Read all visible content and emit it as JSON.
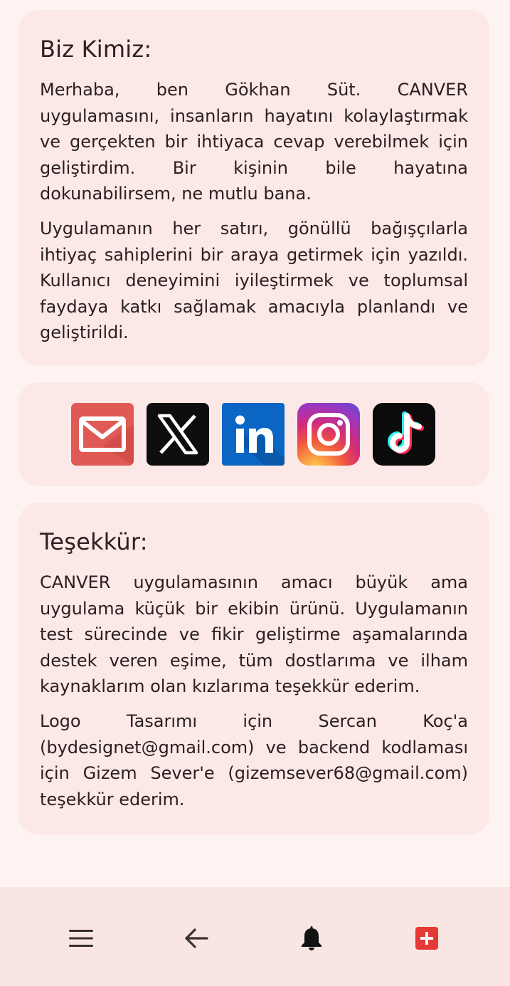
{
  "about": {
    "title": "Biz Kimiz:",
    "paragraphs": [
      "Merhaba, ben Gökhan Süt. CANVER uygulamasını, insanların hayatını kolaylaştırmak ve gerçekten bir ihtiyaca cevap verebilmek için geliştirdim. Bir kişinin bile hayatına dokunabilirsem, ne mutlu bana.",
      "Uygulamanın her satırı, gönüllü bağışçılarla ihtiyaç sahiplerini bir araya getirmek için yazıldı. Kullanıcı deneyimini iyileştirmek ve toplumsal faydaya katkı sağlamak amacıyla planlandı ve geliştirildi."
    ]
  },
  "social": {
    "items": [
      {
        "name": "mail-icon",
        "color": "#e05a55"
      },
      {
        "name": "x-icon",
        "color": "#0e0e0e"
      },
      {
        "name": "linkedin-icon",
        "color": "#0a66c2"
      },
      {
        "name": "instagram-icon",
        "color": "#d22c7a"
      },
      {
        "name": "tiktok-icon",
        "color": "#0b0b0b"
      }
    ]
  },
  "thanks": {
    "title": "Teşekkür:",
    "paragraphs": [
      "CANVER uygulamasının amacı büyük ama uygulama küçük bir ekibin ürünü. Uygulamanın test sürecinde ve fikir geliştirme aşamalarında destek veren eşime, tüm dostlarıma ve ilham kaynaklarım olan kızlarıma teşekkür ederim.",
      "Logo Tasarımı için Sercan Koç'a (bydesignet@gmail.com) ve backend kodlaması için Gizem Sever'e (gizemsever68@gmail.com) teşekkür ederim."
    ]
  },
  "nav": {
    "items": [
      "menu-icon",
      "back-arrow-icon",
      "bell-icon",
      "add-icon"
    ],
    "accent": "#e53935"
  }
}
